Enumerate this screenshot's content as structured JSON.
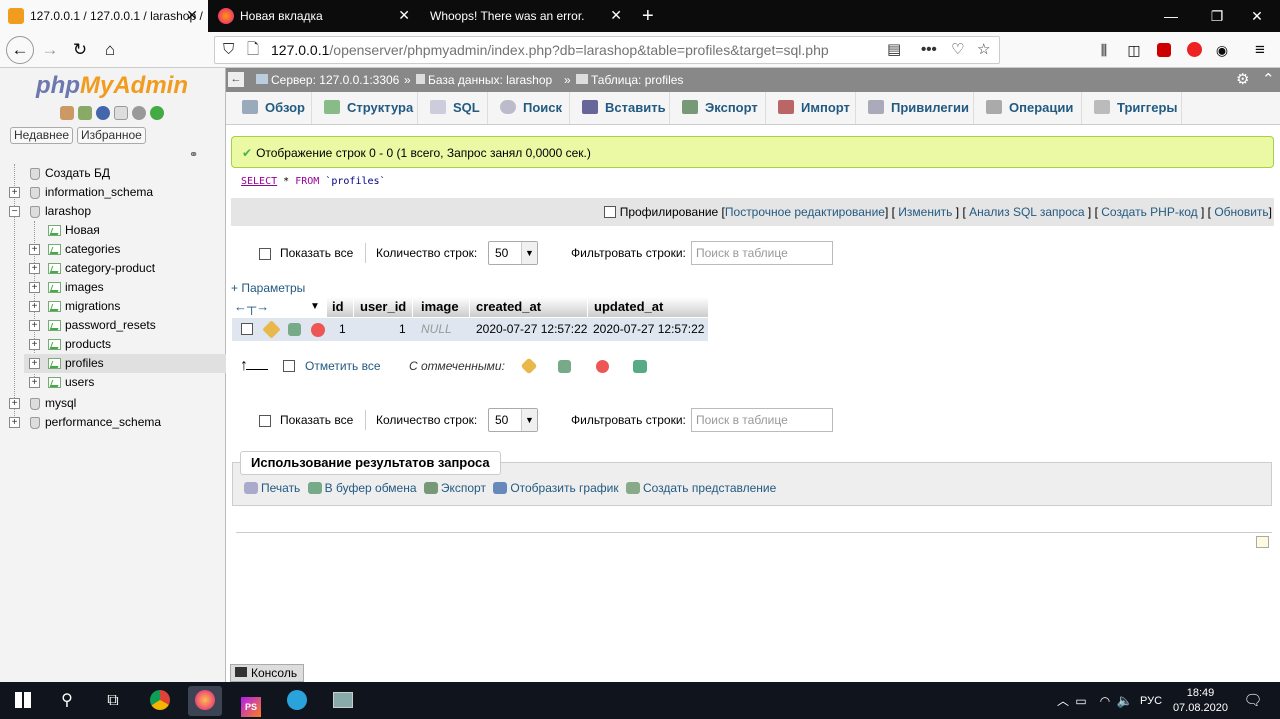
{
  "browser": {
    "tabs": [
      {
        "title": "127.0.0.1 / 127.0.0.1 / larashop / ",
        "active": true
      },
      {
        "title": "Новая вкладка",
        "active": false
      },
      {
        "title": "Whoops! There was an error.",
        "active": false
      }
    ],
    "new_tab": "+",
    "url_host": "127.0.0.1",
    "url_path": "/openserver/phpmyadmin/index.php?db=larashop&table=profiles&target=sql.php",
    "url_more": "•••"
  },
  "pma": {
    "logo_php": "php",
    "logo_myadmin": "MyAdmin",
    "recent_button": "Недавнее",
    "favorites_button": "Избранное",
    "tree": {
      "create_db": "Создать БД",
      "databases": [
        "information_schema",
        "larashop",
        "mysql",
        "performance_schema"
      ],
      "larashop_new": "Новая",
      "tables": [
        "categories",
        "category-product",
        "images",
        "migrations",
        "password_resets",
        "products",
        "profiles",
        "users"
      ],
      "selected_table": "profiles"
    },
    "breadcrumb": {
      "server": "Сервер: 127.0.0.1:3306",
      "sep": "»",
      "database": "База данных: larashop",
      "table": "Таблица: profiles"
    },
    "menu_tabs": [
      "Обзор",
      "Структура",
      "SQL",
      "Поиск",
      "Вставить",
      "Экспорт",
      "Импорт",
      "Привилегии",
      "Операции",
      "Триггеры"
    ],
    "success_message": "Отображение строк 0 - 0 (1 всего, Запрос занял 0,0000 сек.)",
    "sql": {
      "kw_select": "SELECT",
      "star": "*",
      "kw_from": "FROM",
      "table": "`profiles`"
    },
    "sql_options": {
      "profiling": "Профилирование",
      "inline_edit": "Построчное редактирование",
      "edit": "Изменить",
      "explain": "Анализ SQL запроса",
      "php_code": "Создать PHP-код",
      "refresh": "Обновить"
    },
    "nav": {
      "show_all": "Показать все",
      "rows_count_label": "Количество строк:",
      "rows_count_value": "50",
      "filter_label": "Фильтровать строки:",
      "filter_placeholder": "Поиск в таблице"
    },
    "options_link": "+ Параметры",
    "results": {
      "columns": [
        "id",
        "user_id",
        "image",
        "created_at",
        "updated_at"
      ],
      "rows": [
        {
          "id": "1",
          "user_id": "1",
          "image": "NULL",
          "created_at": "2020-07-27 12:57:22",
          "updated_at": "2020-07-27 12:57:22"
        }
      ]
    },
    "with_selected": {
      "check_all": "Отметить все",
      "label": "С отмеченными:"
    },
    "query_results": {
      "title": "Использование результатов запроса",
      "links": [
        "Печать",
        "В буфер обмена",
        "Экспорт",
        "Отобразить график",
        "Создать представление"
      ]
    },
    "console": "Консоль"
  },
  "taskbar": {
    "lang": "РУС",
    "time": "18:49",
    "date": "07.08.2020"
  }
}
